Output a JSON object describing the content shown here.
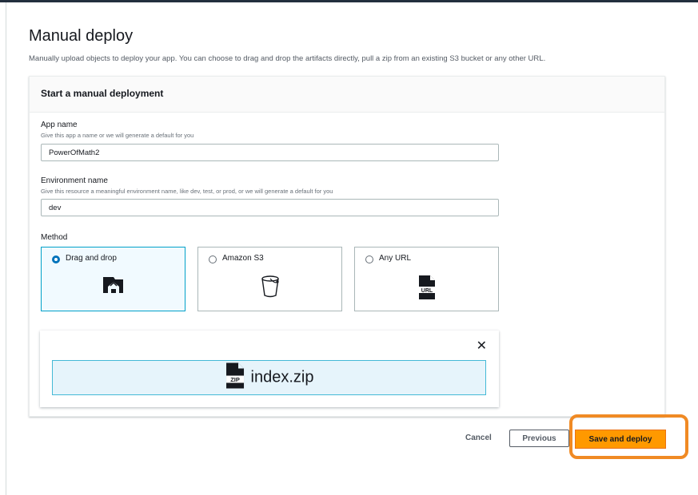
{
  "page": {
    "title": "Manual deploy",
    "description": "Manually upload objects to deploy your app. You can choose to drag and drop the artifacts directly, pull a zip from an existing S3 bucket or any other URL."
  },
  "card": {
    "title": "Start a manual deployment"
  },
  "form": {
    "app_name": {
      "label": "App name",
      "hint": "Give this app a name or we will generate a default for you",
      "value": "PowerOfMath2"
    },
    "env_name": {
      "label": "Environment name",
      "hint": "Give this resource a meaningful environment name, like dev, test, or prod, or we will generate a default for you",
      "value": "dev"
    },
    "method": {
      "label": "Method",
      "selected": "Drag and drop",
      "options": [
        {
          "label": "Drag and drop",
          "icon": "drag-drop-icon"
        },
        {
          "label": "Amazon S3",
          "icon": "bucket-icon"
        },
        {
          "label": "Any URL",
          "icon": "url-file-icon"
        }
      ]
    }
  },
  "upload": {
    "file_name": "index.zip",
    "file_badge": "ZIP",
    "close_icon": "close-icon",
    "close_glyph": "✕"
  },
  "actions": {
    "cancel": "Cancel",
    "previous": "Previous",
    "save_deploy": "Save and deploy"
  },
  "colors": {
    "primary_button": "#ff9900",
    "highlight": "#f08a24",
    "selected_tile": "#f1faff",
    "radio_checked": "#0073bb"
  }
}
